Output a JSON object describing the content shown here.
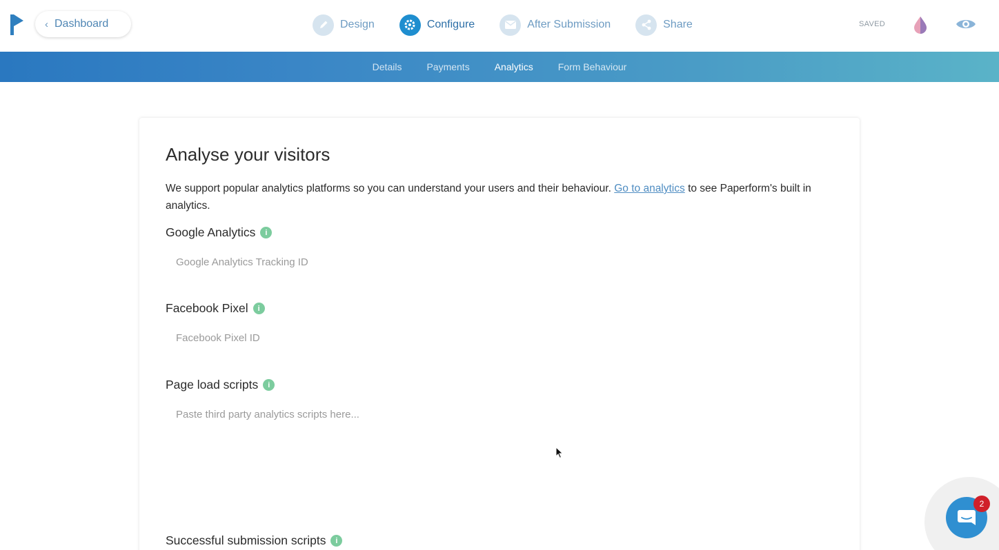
{
  "header": {
    "dashboard_label": "Dashboard",
    "steps": [
      {
        "label": "Design",
        "icon": "pencil-icon"
      },
      {
        "label": "Configure",
        "icon": "gear-icon"
      },
      {
        "label": "After Submission",
        "icon": "envelope-icon"
      },
      {
        "label": "Share",
        "icon": "share-icon"
      }
    ],
    "active_step": "Configure",
    "saved_status": "SAVED"
  },
  "subnav": {
    "tabs": [
      "Details",
      "Payments",
      "Analytics",
      "Form Behaviour"
    ],
    "active_tab": "Analytics"
  },
  "main": {
    "title": "Analyse your visitors",
    "intro_text_before": "We support popular analytics platforms so you can understand your users and their behaviour. ",
    "intro_link": "Go to analytics",
    "intro_text_after": " to see Paperform's built in analytics.",
    "fields": [
      {
        "label": "Google Analytics",
        "placeholder": "Google Analytics Tracking ID",
        "value": ""
      },
      {
        "label": "Facebook Pixel",
        "placeholder": "Facebook Pixel ID",
        "value": ""
      },
      {
        "label": "Page load scripts",
        "placeholder": "Paste third party analytics scripts here...",
        "value": ""
      },
      {
        "label": "Successful submission scripts",
        "placeholder": "",
        "value": ""
      }
    ]
  },
  "chat": {
    "unread_count": "2"
  },
  "colors": {
    "brand_blue": "#2d6fa7",
    "accent_blue": "#1f8ecf",
    "info_green": "#7ccc9e",
    "badge_red": "#d0202a"
  }
}
